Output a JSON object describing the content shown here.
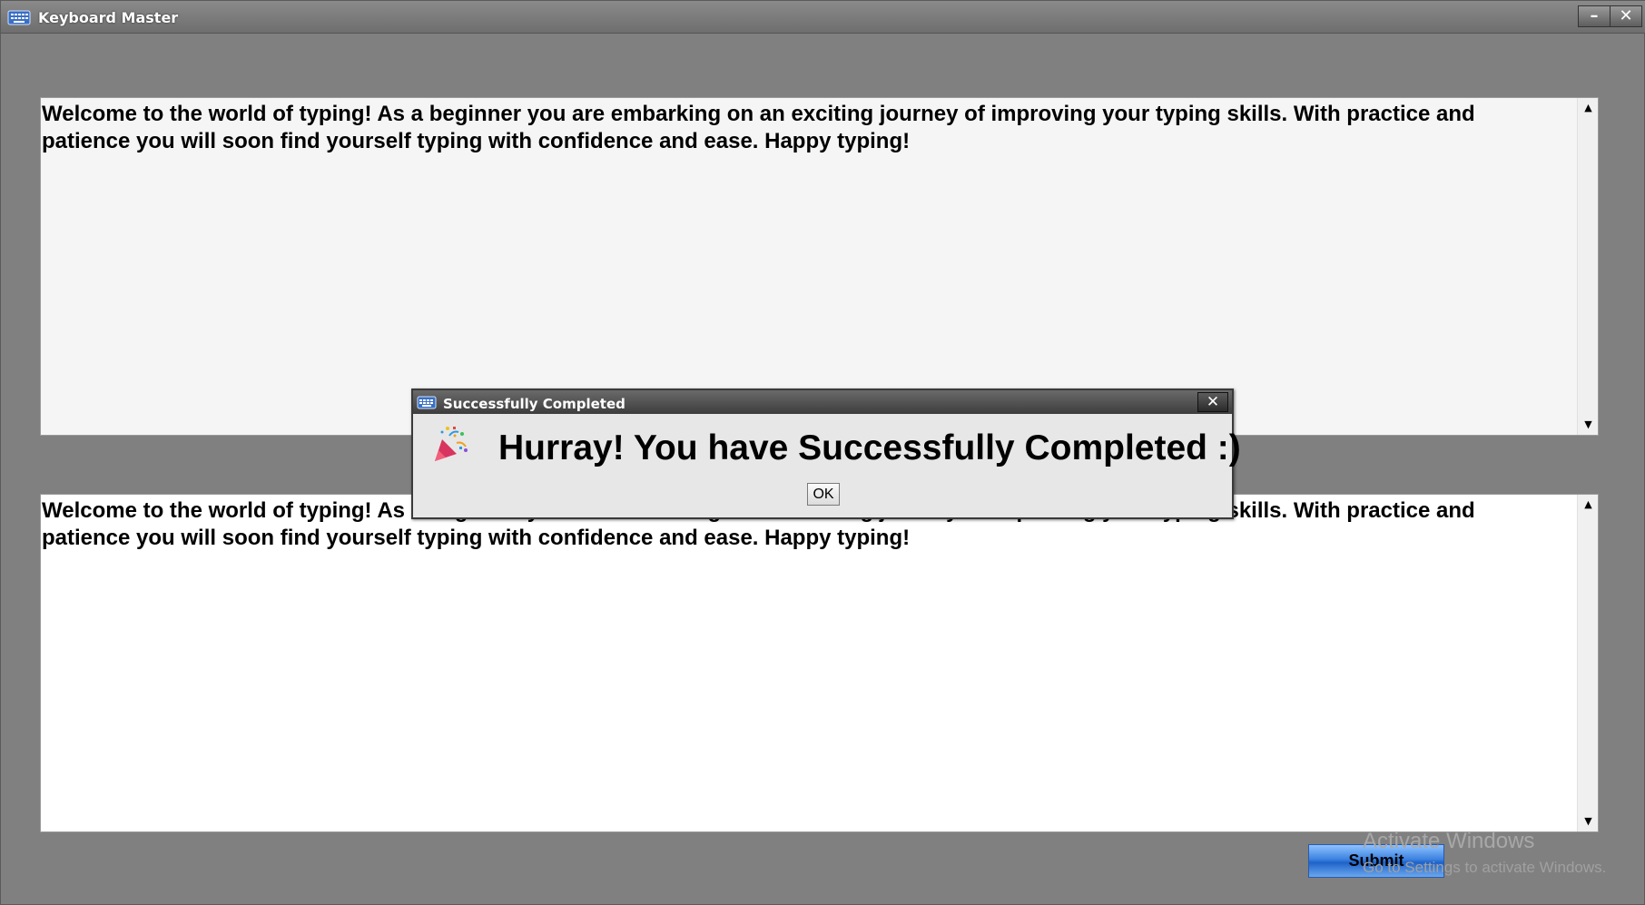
{
  "window": {
    "title": "Keyboard Master",
    "minimize_label": "–",
    "close_label": "✕"
  },
  "reference_text": "Welcome to the world of typing! As a beginner you are embarking on an exciting journey of improving your typing skills. With practice and patience you will soon find yourself typing with confidence and ease. Happy typing!",
  "typed_text": "Welcome to the world of typing! As a beginner you are embarking on an exciting journey of improving your typing skills. With practice and patience you will soon find yourself typing with confidence and ease. Happy typing!",
  "scrollbar": {
    "up_label": "▲",
    "down_label": "▼"
  },
  "submit_label": "Submit",
  "watermark": {
    "line1": "Activate Windows",
    "line2": "Go to Settings to activate Windows."
  },
  "dialog": {
    "title": "Successfully Completed",
    "close_label": "✕",
    "message": "Hurray! You have Successfully Completed :)",
    "ok_label": "OK"
  },
  "colors": {
    "background": "#808080",
    "submit_accent": "#3b82e0"
  },
  "icons": {
    "app": "keyboard-icon",
    "dialog": "party-popper-icon"
  }
}
